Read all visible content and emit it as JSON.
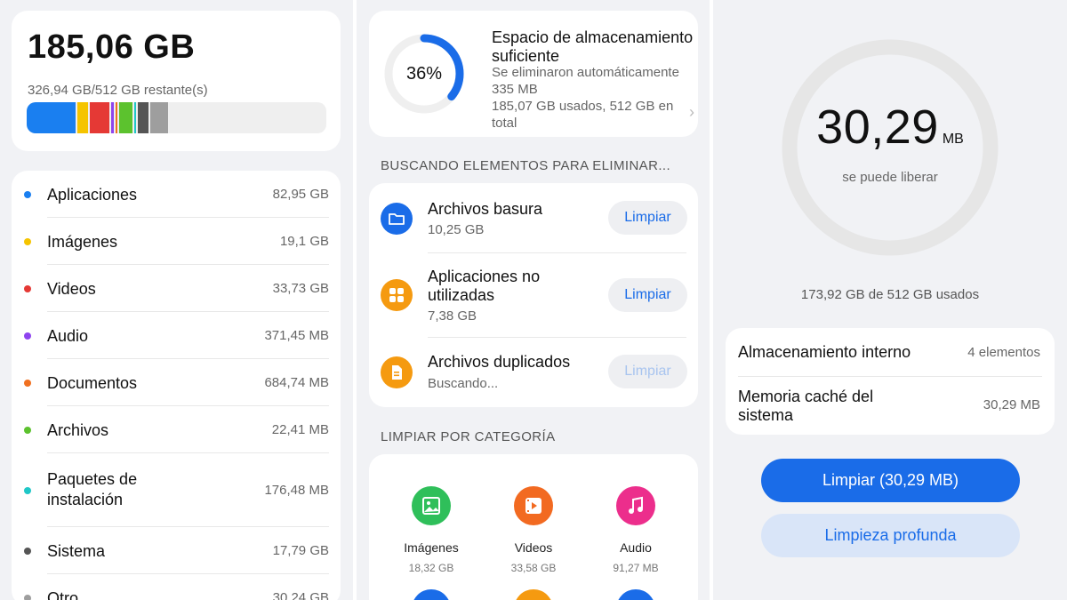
{
  "storage_summary": {
    "used": "185,06 GB",
    "remaining": "326,94 GB/512 GB restante(s)",
    "bar_segments": [
      {
        "color": "#1a7ff0",
        "fraction": 0.162
      },
      {
        "color": "#f5c400",
        "fraction": 0.037
      },
      {
        "color": "#e53935",
        "fraction": 0.066
      },
      {
        "color": "#8e44ef",
        "fraction": 0.007
      },
      {
        "color": "#f07020",
        "fraction": 0.007
      },
      {
        "color": "#5cc22e",
        "fraction": 0.044
      },
      {
        "color": "#1fc7c7",
        "fraction": 0.007
      },
      {
        "color": "#555555",
        "fraction": 0.035
      },
      {
        "color": "#9e9e9e",
        "fraction": 0.059
      }
    ]
  },
  "categories": [
    {
      "name": "Aplicaciones",
      "size": "82,95 GB",
      "color": "#1a7ff0"
    },
    {
      "name": "Imágenes",
      "size": "19,1 GB",
      "color": "#f5c400"
    },
    {
      "name": "Videos",
      "size": "33,73 GB",
      "color": "#e53935"
    },
    {
      "name": "Audio",
      "size": "371,45 MB",
      "color": "#8e44ef"
    },
    {
      "name": "Documentos",
      "size": "684,74 MB",
      "color": "#f07020"
    },
    {
      "name": "Archivos",
      "size": "22,41 MB",
      "color": "#5cc22e"
    },
    {
      "name": "Paquetes de instalación",
      "size": "176,48 MB",
      "color": "#1fc7c7"
    },
    {
      "name": "Sistema",
      "size": "17,79 GB",
      "color": "#555555"
    },
    {
      "name": "Otro",
      "size": "30,24 GB",
      "color": "#9e9e9e"
    }
  ],
  "status": {
    "percent": "36%",
    "percent_value": 0.36,
    "title": "Espacio de almacenamiento suficiente",
    "line1": "Se eliminaron automáticamente 335 MB",
    "line2": "185,07 GB usados, 512 GB en total",
    "chevron": "›"
  },
  "scan": {
    "section_title": "BUSCANDO ELEMENTOS PARA ELIMINAR...",
    "items": [
      {
        "title": "Archivos basura",
        "subtitle": "10,25 GB",
        "button": "Limpiar",
        "icon": "folder-icon",
        "color": "#1a6ce8",
        "enabled": true
      },
      {
        "title": "Aplicaciones no utilizadas",
        "subtitle": "7,38 GB",
        "button": "Limpiar",
        "icon": "apps-grid-icon",
        "color": "#f59a10",
        "enabled": true
      },
      {
        "title": "Archivos duplicados",
        "subtitle": "Buscando...",
        "button": "Limpiar",
        "icon": "duplicate-files-icon",
        "color": "#f59a10",
        "enabled": false
      }
    ]
  },
  "category_clean": {
    "section_title": "LIMPIAR POR CATEGORÍA",
    "items": [
      {
        "name": "Imágenes",
        "size": "18,32 GB",
        "icon": "image-icon",
        "color": "#2fbf5a"
      },
      {
        "name": "Videos",
        "size": "33,58 GB",
        "icon": "video-icon",
        "color": "#f26a21"
      },
      {
        "name": "Audio",
        "size": "91,27 MB",
        "icon": "music-note-icon",
        "color": "#ec2e8c"
      }
    ],
    "peek_colors": [
      "#1a6ce8",
      "#f59a10",
      "#1a6ce8"
    ]
  },
  "cleanup": {
    "amount": "30,29",
    "unit": "MB",
    "label": "se puede liberar",
    "used_text": "173,92 GB de 512 GB usados",
    "rows": [
      {
        "label": "Almacenamiento interno",
        "value": "4 elementos"
      },
      {
        "label": "Memoria caché del sistema",
        "value": "30,29 MB"
      }
    ],
    "clean_button": "Limpiar (30,29 MB)",
    "deep_button": "Limpieza profunda"
  }
}
